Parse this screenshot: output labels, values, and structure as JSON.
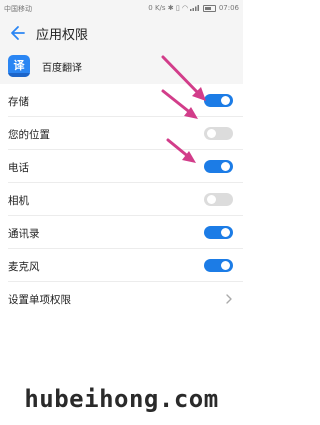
{
  "status_bar": {
    "carrier": "中国移动",
    "speed": "0 K/s",
    "battery_percent": "",
    "time": "07:06",
    "icons": [
      "signal-icon",
      "bluetooth-icon",
      "vibrate-icon",
      "wifi-icon",
      "battery-icon"
    ]
  },
  "header": {
    "back_icon": "back-arrow-icon",
    "title": "应用权限"
  },
  "app": {
    "icon_glyph": "译",
    "name": "百度翻译"
  },
  "permissions": [
    {
      "label": "存储",
      "enabled": true
    },
    {
      "label": "您的位置",
      "enabled": false
    },
    {
      "label": "电话",
      "enabled": true
    },
    {
      "label": "相机",
      "enabled": false
    },
    {
      "label": "通讯录",
      "enabled": true
    },
    {
      "label": "麦克风",
      "enabled": true
    }
  ],
  "single_permissions": {
    "label": "设置单项权限",
    "icon": "chevron-right-icon"
  },
  "annotations": {
    "arrow_color": "#d23d8a",
    "arrow_targets": [
      "存储",
      "您的位置",
      "电话"
    ]
  },
  "watermark": "hubeihong.com",
  "colors": {
    "toggle_on": "#1c7ce6",
    "toggle_off": "#dcdcdc",
    "app_icon": "#2b86f3"
  }
}
